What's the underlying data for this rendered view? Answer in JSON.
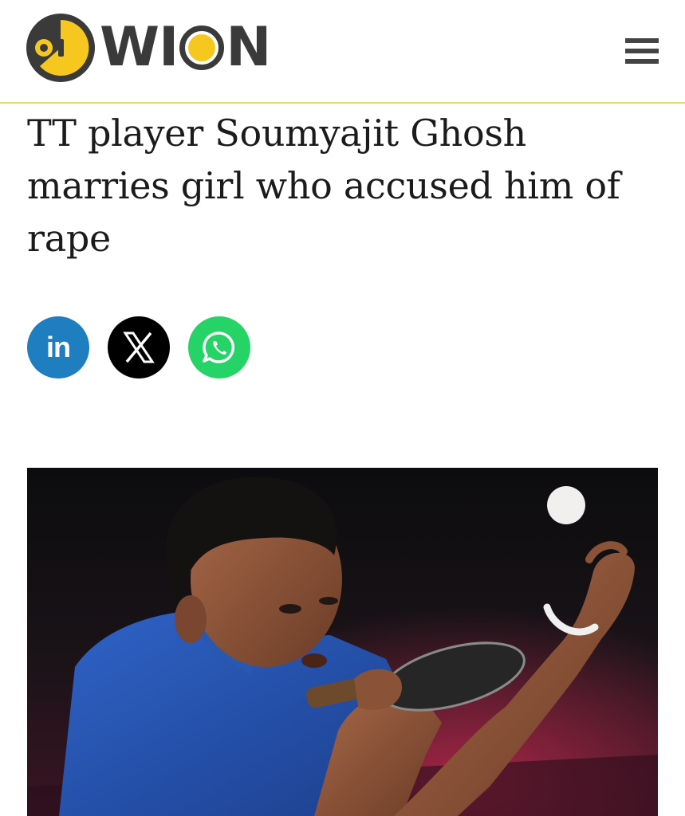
{
  "header": {
    "logo_text": "WION",
    "menu_icon": "hamburger-menu-icon",
    "accent_color": "#e8d56a",
    "logo_yellow": "#f6c81f",
    "logo_dark": "#3a3a3a"
  },
  "article": {
    "headline": "TT player Soumyajit Ghosh marries girl who accused him of rape"
  },
  "share": {
    "linkedin": {
      "label": "in",
      "icon": "linkedin-icon",
      "color": "#1f7ec0"
    },
    "x": {
      "icon": "x-icon",
      "color": "#000000"
    },
    "whatsapp": {
      "icon": "whatsapp-icon",
      "color": "#25d366"
    }
  },
  "photo": {
    "icon": "table-tennis-player-photo"
  }
}
